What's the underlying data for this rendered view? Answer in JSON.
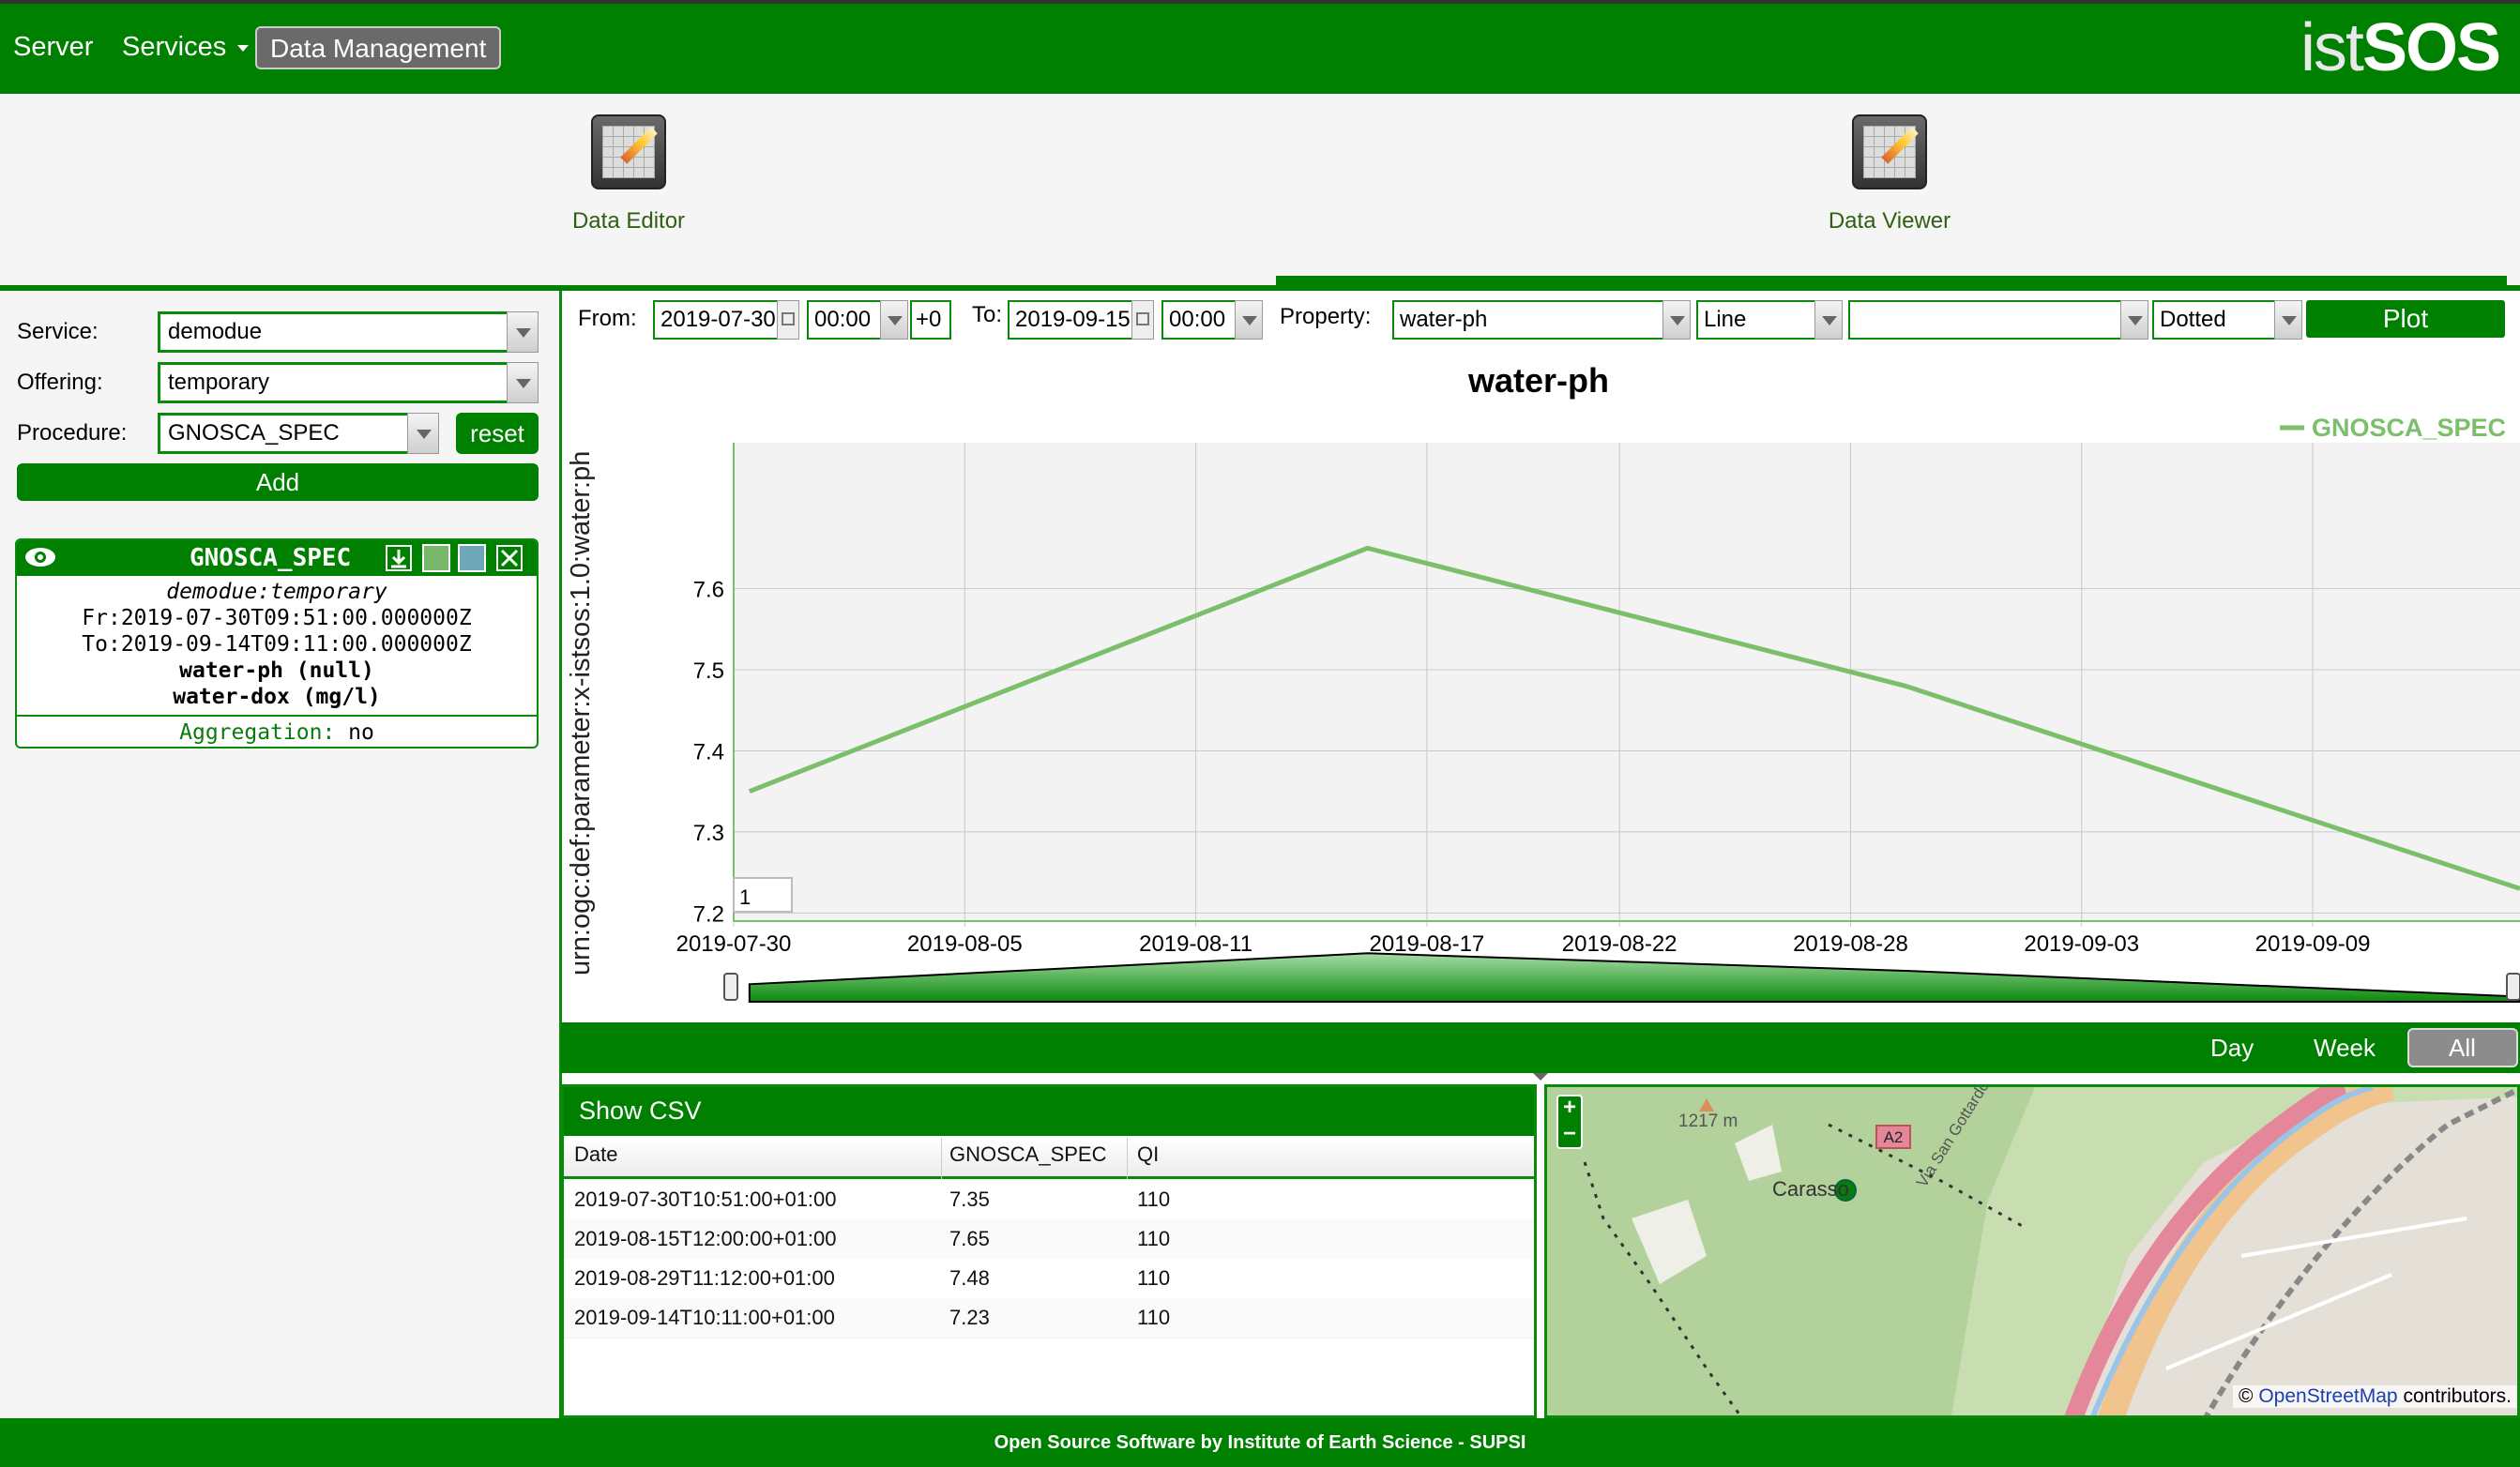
{
  "nav": {
    "server": "Server",
    "services": "Services",
    "data_management": "Data Management",
    "logo_thin": "ist",
    "logo_bold": "SOS"
  },
  "tools": {
    "data_editor": "Data Editor",
    "data_viewer": "Data Viewer"
  },
  "left": {
    "service_label": "Service:",
    "service_value": "demodue",
    "offering_label": "Offering:",
    "offering_value": "temporary",
    "procedure_label": "Procedure:",
    "procedure_value": "GNOSCA_SPEC",
    "reset_label": "reset",
    "add_label": "Add"
  },
  "card": {
    "title": "GNOSCA_SPEC",
    "subtitle": "demodue:temporary",
    "from": "Fr:2019-07-30T09:51:00.000000Z",
    "to": "To:2019-09-14T09:11:00.000000Z",
    "prop1": "water-ph (null)",
    "prop2": "water-dox (mg/l)",
    "aggregation_label": "Aggregation:",
    "aggregation_value": "no",
    "colors": [
      "#79b86b",
      "#6ea8b6"
    ]
  },
  "toolbar": {
    "from_label": "From:",
    "from_date": "2019-07-30",
    "from_time": "00:00",
    "tz": "+0",
    "to_label": "To:",
    "to_date": "2019-09-15",
    "to_time": "00:00",
    "property_label": "Property:",
    "property_value": "water-ph",
    "style_value": "Line",
    "extra_value": "",
    "dash_value": "Dotted",
    "plot_label": "Plot"
  },
  "chart_data": {
    "type": "line",
    "title": "water-ph",
    "ylabel": "urn:ogc:def:parameter:x-istsos:1.0:water:ph",
    "legend": "top-right",
    "grid": true,
    "ylim": [
      7.19,
      7.78
    ],
    "xlim": [
      "2019-07-30",
      "2019-09-14"
    ],
    "yticks": [
      "7.2",
      "7.3",
      "7.4",
      "7.5",
      "7.6"
    ],
    "xticks": [
      "2019-07-30",
      "2019-08-05",
      "2019-08-11",
      "2019-08-17",
      "2019-08-22",
      "2019-08-28",
      "2019-09-03",
      "2019-09-09"
    ],
    "series": [
      {
        "name": "GNOSCA_SPEC",
        "color": "#7cbf6b",
        "x": [
          "2019-07-30T09:51",
          "2019-08-15T11:00",
          "2019-08-29T10:12",
          "2019-09-14T09:11"
        ],
        "y": [
          7.35,
          7.65,
          7.48,
          7.23
        ]
      }
    ],
    "roller_value": "1"
  },
  "range": {
    "day": "Day",
    "week": "Week",
    "all": "All"
  },
  "csv": {
    "title": "Show CSV",
    "headers": [
      "Date",
      "GNOSCA_SPEC",
      "QI"
    ],
    "rows": [
      [
        "2019-07-30T10:51:00+01:00",
        "7.35",
        "110"
      ],
      [
        "2019-08-15T12:00:00+01:00",
        "7.65",
        "110"
      ],
      [
        "2019-08-29T11:12:00+01:00",
        "7.48",
        "110"
      ],
      [
        "2019-09-14T10:11:00+01:00",
        "7.23",
        "110"
      ]
    ]
  },
  "map": {
    "zoom_in": "+",
    "zoom_out": "−",
    "place": "Carasso",
    "elevation": "1217 m",
    "road": "A2",
    "street": "Via San Gottardo",
    "attribution_prefix": "©",
    "attribution_link": "OpenStreetMap",
    "attribution_suffix": "contributors."
  },
  "footer": "Open Source Software by Institute of Earth Science - SUPSI"
}
